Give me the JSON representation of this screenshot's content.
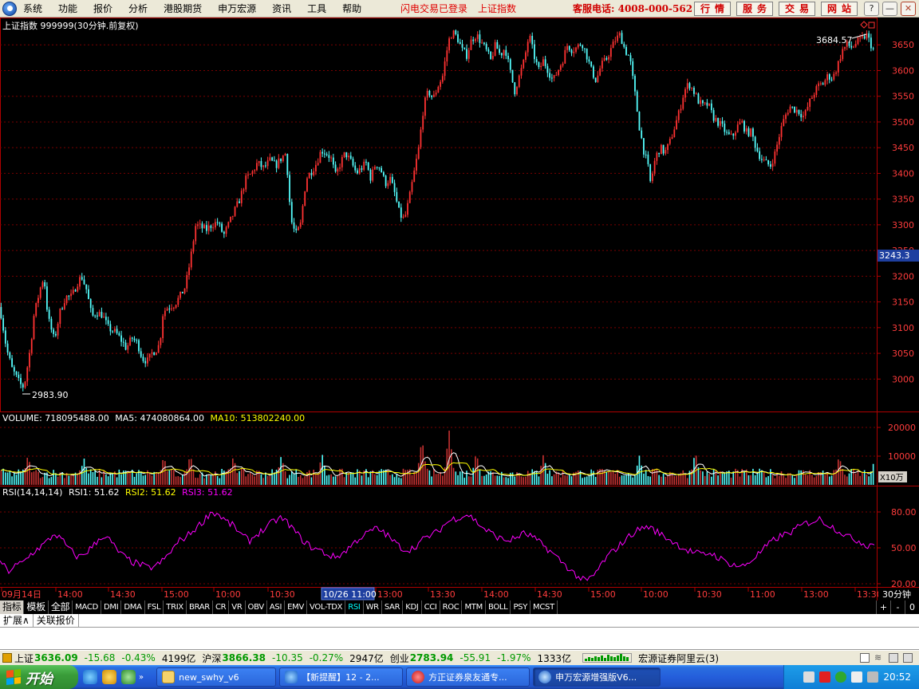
{
  "menu": {
    "items": [
      "系统",
      "功能",
      "报价",
      "分析",
      "港股期货",
      "申万宏源",
      "资讯",
      "工具",
      "帮助"
    ],
    "login_status": "闪电交易已登录",
    "index_link": "上证指数",
    "hotline": "客服电话: 4008-000-562",
    "buttons": [
      "行情",
      "服务",
      "交易",
      "网站"
    ]
  },
  "window_controls": {
    "help": "?",
    "minimize": "—",
    "restore": "❐",
    "close": "✕"
  },
  "price_panel": {
    "header": "上证指数 999999(30分钟.前复权)",
    "y_ticks": [
      "3650",
      "3600",
      "3550",
      "3500",
      "3450",
      "3400",
      "3350",
      "3300",
      "3250",
      "3200",
      "3150",
      "3100",
      "3050",
      "3000"
    ],
    "high_label": "3684.57",
    "low_label": "2983.90",
    "cursor_price": "3243.3"
  },
  "volume_panel": {
    "label": "VOLUME: 718095488.00",
    "ma5_label": "MA5: 474080864.00",
    "ma10_label": "MA10: 513802240.00",
    "y_ticks": [
      "20000",
      "10000"
    ],
    "unit": "X10万"
  },
  "rsi_panel": {
    "label": "RSI(14,14,14)",
    "rsi1_label": "RSI1: 51.62",
    "rsi2_label": "RSI2: 51.62",
    "rsi3_label": "RSI3: 51.62",
    "y_ticks": [
      "80.00",
      "50.00",
      "20.00"
    ]
  },
  "time_axis": {
    "labels": [
      "09月14日",
      "14:00",
      "14:30",
      "15:00",
      "10:00",
      "10:30",
      "11:00",
      "13:00",
      "13:30",
      "14:00",
      "14:30",
      "15:00",
      "10:00",
      "10:30",
      "11:00",
      "13:00",
      "13:30"
    ],
    "cursor_label": "10/26 11:00",
    "period": "30分钟"
  },
  "indicator_tabs": [
    "指标",
    "模板",
    "全部",
    "MACD",
    "DMI",
    "DMA",
    "FSL",
    "TRIX",
    "BRAR",
    "CR",
    "VR",
    "OBV",
    "ASI",
    "EMV",
    "VOL-TDX",
    "RSI",
    "WR",
    "SAR",
    "KDJ",
    "CCI",
    "ROC",
    "MTM",
    "BOLL",
    "PSY",
    "MCST"
  ],
  "active_tab": "RSI",
  "tab_controls": [
    "+",
    "-",
    "0"
  ],
  "ext_tabs": [
    "扩展∧",
    "关联报价"
  ],
  "status_bar": {
    "sh_label": "上证",
    "sh_value": "3636.09",
    "sh_change": "-15.68",
    "sh_pct": "-0.43%",
    "sh_amount": "4199亿",
    "hs_label": "沪深",
    "hs_value": "3866.38",
    "hs_change": "-10.35",
    "hs_pct": "-0.27%",
    "hs_amount": "2947亿",
    "cy_label": "创业",
    "cy_value": "2783.94",
    "cy_change": "-55.91",
    "cy_pct": "-1.97%",
    "cy_amount": "1333亿",
    "broker": "宏源证券阿里云(3)"
  },
  "taskbar": {
    "start": "开始",
    "tasks": [
      "new_swhy_v6",
      "【新提醒】12 - 2...",
      "方正证券泉友通专...",
      "申万宏源增强版V6..."
    ],
    "clock": "20:52"
  },
  "colors": {
    "up": "#ff3232",
    "down": "#54fcfc",
    "ma5": "#ffffff",
    "ma10": "#ffff00",
    "rsi": "#ff00ff",
    "grid": "#7a0000",
    "axis_text": "#ff3c3c",
    "cursor_bg": "#1e3fa0"
  },
  "chart_data": [
    {
      "type": "candlestick",
      "title": "上证指数 999999(30分钟.前复权)",
      "ylim": [
        2940,
        3700
      ],
      "x_count": 400,
      "anchors": [
        [
          0,
          3140
        ],
        [
          8,
          3060
        ],
        [
          15,
          3020
        ],
        [
          25,
          2990
        ],
        [
          30,
          2984
        ],
        [
          38,
          3060
        ],
        [
          42,
          3120
        ],
        [
          50,
          3175
        ],
        [
          55,
          3200
        ],
        [
          60,
          3120
        ],
        [
          68,
          3075
        ],
        [
          75,
          3130
        ],
        [
          82,
          3160
        ],
        [
          90,
          3160
        ],
        [
          96,
          3185
        ],
        [
          102,
          3200
        ],
        [
          108,
          3175
        ],
        [
          115,
          3120
        ],
        [
          120,
          3130
        ],
        [
          128,
          3125
        ],
        [
          135,
          3100
        ],
        [
          145,
          3090
        ],
        [
          152,
          3075
        ],
        [
          158,
          3060
        ],
        [
          165,
          3080
        ],
        [
          172,
          3070
        ],
        [
          178,
          3040
        ],
        [
          185,
          3035
        ],
        [
          190,
          3050
        ],
        [
          197,
          3060
        ],
        [
          200,
          3070
        ],
        [
          204,
          3130
        ],
        [
          210,
          3140
        ],
        [
          218,
          3145
        ],
        [
          225,
          3160
        ],
        [
          232,
          3180
        ],
        [
          238,
          3230
        ],
        [
          245,
          3300
        ],
        [
          252,
          3295
        ],
        [
          258,
          3290
        ],
        [
          265,
          3300
        ],
        [
          272,
          3305
        ],
        [
          280,
          3280
        ],
        [
          286,
          3300
        ],
        [
          293,
          3325
        ],
        [
          300,
          3350
        ],
        [
          308,
          3390
        ],
        [
          315,
          3400
        ],
        [
          322,
          3420
        ],
        [
          330,
          3410
        ],
        [
          338,
          3425
        ],
        [
          345,
          3415
        ],
        [
          352,
          3430
        ],
        [
          358,
          3440
        ],
        [
          364,
          3310
        ],
        [
          370,
          3280
        ],
        [
          376,
          3300
        ],
        [
          383,
          3390
        ],
        [
          390,
          3405
        ],
        [
          396,
          3420
        ],
        [
          402,
          3445
        ],
        [
          408,
          3440
        ],
        [
          414,
          3430
        ],
        [
          420,
          3395
        ],
        [
          426,
          3420
        ],
        [
          432,
          3440
        ],
        [
          440,
          3420
        ],
        [
          446,
          3400
        ],
        [
          452,
          3410
        ],
        [
          458,
          3420
        ],
        [
          464,
          3390
        ],
        [
          470,
          3420
        ],
        [
          476,
          3410
        ],
        [
          482,
          3380
        ],
        [
          488,
          3390
        ],
        [
          494,
          3360
        ],
        [
          500,
          3320
        ],
        [
          506,
          3310
        ],
        [
          512,
          3350
        ],
        [
          518,
          3400
        ],
        [
          524,
          3450
        ],
        [
          530,
          3530
        ],
        [
          536,
          3560
        ],
        [
          542,
          3545
        ],
        [
          548,
          3570
        ],
        [
          554,
          3590
        ],
        [
          558,
          3630
        ],
        [
          562,
          3660
        ],
        [
          566,
          3675
        ],
        [
          572,
          3665
        ],
        [
          578,
          3640
        ],
        [
          584,
          3630
        ],
        [
          590,
          3660
        ],
        [
          596,
          3670
        ],
        [
          602,
          3655
        ],
        [
          608,
          3640
        ],
        [
          614,
          3620
        ],
        [
          620,
          3650
        ],
        [
          626,
          3630
        ],
        [
          632,
          3645
        ],
        [
          638,
          3600
        ],
        [
          644,
          3560
        ],
        [
          650,
          3590
        ],
        [
          656,
          3620
        ],
        [
          662,
          3670
        ],
        [
          668,
          3630
        ],
        [
          674,
          3600
        ],
        [
          680,
          3620
        ],
        [
          686,
          3600
        ],
        [
          692,
          3580
        ],
        [
          698,
          3600
        ],
        [
          704,
          3620
        ],
        [
          710,
          3650
        ],
        [
          716,
          3640
        ],
        [
          722,
          3645
        ],
        [
          728,
          3655
        ],
        [
          734,
          3630
        ],
        [
          740,
          3600
        ],
        [
          746,
          3580
        ],
        [
          752,
          3610
        ],
        [
          758,
          3620
        ],
        [
          764,
          3640
        ],
        [
          770,
          3660
        ],
        [
          776,
          3670
        ],
        [
          782,
          3640
        ],
        [
          788,
          3625
        ],
        [
          794,
          3560
        ],
        [
          800,
          3490
        ],
        [
          806,
          3440
        ],
        [
          810,
          3420
        ],
        [
          814,
          3380
        ],
        [
          820,
          3430
        ],
        [
          826,
          3450
        ],
        [
          832,
          3440
        ],
        [
          838,
          3460
        ],
        [
          844,
          3490
        ],
        [
          850,
          3520
        ],
        [
          856,
          3560
        ],
        [
          862,
          3575
        ],
        [
          868,
          3560
        ],
        [
          874,
          3540
        ],
        [
          880,
          3530
        ],
        [
          886,
          3535
        ],
        [
          892,
          3510
        ],
        [
          898,
          3500
        ],
        [
          904,
          3490
        ],
        [
          910,
          3475
        ],
        [
          916,
          3470
        ],
        [
          922,
          3490
        ],
        [
          928,
          3500
        ],
        [
          934,
          3480
        ],
        [
          940,
          3480
        ],
        [
          946,
          3450
        ],
        [
          952,
          3430
        ],
        [
          958,
          3420
        ],
        [
          964,
          3415
        ],
        [
          970,
          3440
        ],
        [
          976,
          3480
        ],
        [
          982,
          3510
        ],
        [
          988,
          3530
        ],
        [
          994,
          3525
        ],
        [
          1000,
          3520
        ],
        [
          1006,
          3510
        ],
        [
          1012,
          3535
        ],
        [
          1018,
          3555
        ],
        [
          1024,
          3570
        ],
        [
          1030,
          3575
        ],
        [
          1036,
          3590
        ],
        [
          1042,
          3585
        ],
        [
          1048,
          3610
        ],
        [
          1054,
          3640
        ],
        [
          1060,
          3650
        ],
        [
          1066,
          3645
        ],
        [
          1072,
          3655
        ],
        [
          1078,
          3660
        ],
        [
          1084,
          3670
        ],
        [
          1090,
          3650
        ],
        [
          1094,
          3636
        ]
      ],
      "x_anchor_scale": 1094,
      "high": 3684.57,
      "low": 2983.9,
      "current": 3243.3
    },
    {
      "type": "bar",
      "title": "VOLUME",
      "ylabel": "X10万",
      "ylim": [
        0,
        25000
      ],
      "base": 4200,
      "series": [
        {
          "name": "VOLUME",
          "values": []
        },
        {
          "name": "MA5",
          "values": []
        },
        {
          "name": "MA10",
          "values": []
        }
      ],
      "spikes": [
        [
          35,
          10500
        ],
        [
          105,
          9500
        ],
        [
          205,
          10200
        ],
        [
          238,
          10800
        ],
        [
          292,
          10100
        ],
        [
          352,
          10400
        ],
        [
          403,
          11000
        ],
        [
          528,
          16200
        ],
        [
          562,
          19000
        ],
        [
          596,
          11500
        ],
        [
          680,
          10800
        ],
        [
          800,
          10200
        ],
        [
          870,
          11800
        ],
        [
          1050,
          10300
        ],
        [
          1094,
          8800
        ]
      ],
      "last": 7180.95488,
      "ma5_last": 4740.80864,
      "ma10_last": 5138.0224
    },
    {
      "type": "line",
      "title": "RSI(14,14,14)",
      "ylim": [
        18,
        100
      ],
      "series": [
        {
          "name": "RSI1",
          "values": [
            40,
            30,
            35,
            38,
            45,
            50,
            55,
            62,
            56,
            48,
            42,
            46,
            52,
            60,
            57,
            48,
            42,
            38,
            36,
            33,
            35,
            40,
            48,
            56,
            60,
            66,
            72,
            80,
            78,
            72,
            68,
            60,
            56,
            62,
            66,
            72,
            75,
            70,
            62,
            55,
            50,
            48,
            44,
            42,
            46,
            52,
            58,
            62,
            66,
            64,
            58,
            52,
            48,
            50,
            56,
            60,
            63,
            70,
            74,
            76,
            78,
            72,
            66,
            62,
            58,
            56,
            58,
            62,
            60,
            55,
            50,
            44,
            38,
            32,
            26,
            22,
            26,
            36,
            44,
            50,
            56,
            62,
            66,
            68,
            64,
            60,
            56,
            52,
            48,
            46,
            44,
            46,
            42,
            38,
            36,
            34,
            38,
            44,
            50,
            56,
            60,
            62,
            66,
            70,
            72,
            74,
            70,
            66,
            62,
            58,
            56,
            52,
            54
          ]
        }
      ],
      "x_anchor_scale": 1094,
      "last": 51.62
    }
  ]
}
